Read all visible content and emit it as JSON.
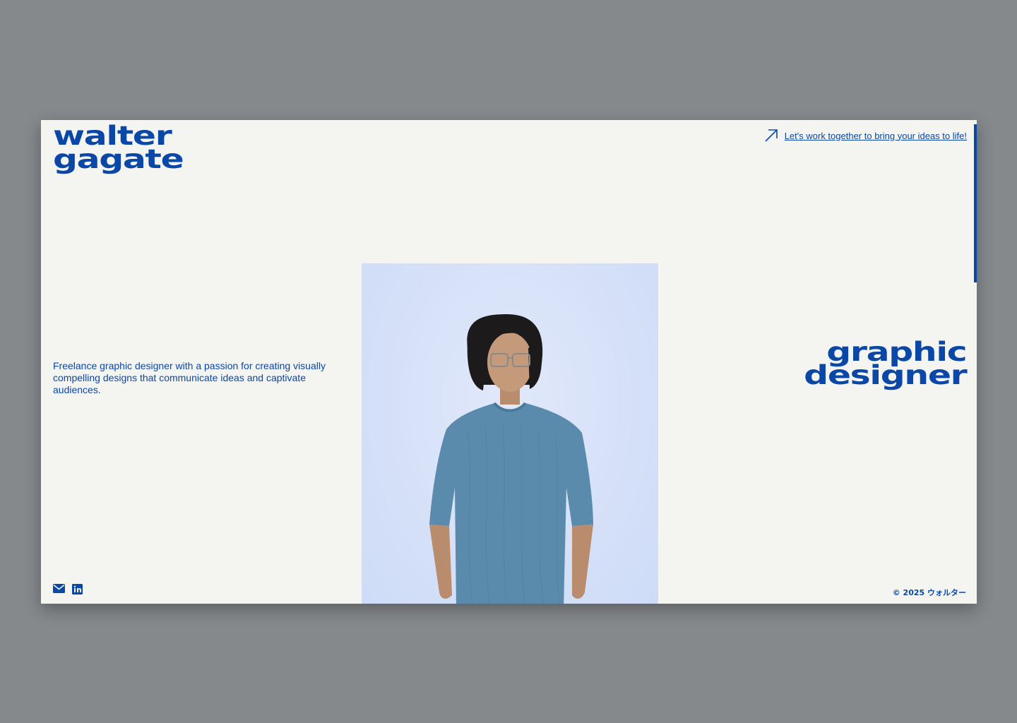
{
  "brand": {
    "line1": "walter",
    "line2": "gagate"
  },
  "header": {
    "cta_label": "Let's work together to bring your ideas to life!"
  },
  "bio": "Freelance graphic designer with a passion for creating visually compelling designs that communicate ideas and captivate audiences.",
  "role": {
    "line1": "graphic",
    "line2": "designer"
  },
  "social": {
    "icons": [
      "mail-icon",
      "linkedin-icon"
    ]
  },
  "footer": {
    "copyright": "© 2025 ウォルター"
  },
  "colors": {
    "accent": "#0b47a6",
    "background": "#f4f4f1",
    "photo_bg": "#d6e2f8",
    "shirt": "#5b8bac"
  }
}
